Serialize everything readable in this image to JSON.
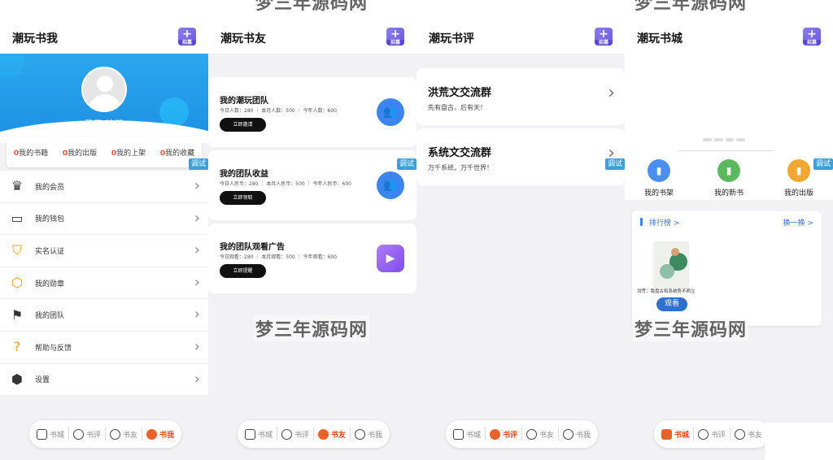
{
  "watermark": "梦三年源码网",
  "debug_label": "调试",
  "tabs": {
    "mall": "书城",
    "review": "书评",
    "friends": "书友",
    "me": "书我"
  },
  "corner_badge": "招募",
  "screen1": {
    "title": "潮玩书我",
    "login": "登录/注册",
    "stats": [
      {
        "num": "0",
        "label": "我的书籍"
      },
      {
        "num": "0",
        "label": "我的出版"
      },
      {
        "num": "0",
        "label": "我的上架"
      },
      {
        "num": "0",
        "label": "我的收藏"
      }
    ],
    "menu": [
      {
        "label": "我的会员",
        "icon": "crown-icon"
      },
      {
        "label": "我的钱包",
        "icon": "wallet-icon"
      },
      {
        "label": "实名认证",
        "icon": "shield-check-icon"
      },
      {
        "label": "我的勋章",
        "icon": "medal-icon"
      },
      {
        "label": "我的团队",
        "icon": "flag-icon"
      },
      {
        "label": "帮助与反馈",
        "icon": "question-icon"
      },
      {
        "label": "设置",
        "icon": "settings-icon"
      }
    ]
  },
  "screen2": {
    "title": "潮玩书友",
    "cards": [
      {
        "title": "我的潮玩团队",
        "sub": "今日人数：280 ｜ 本月人数：500 ｜ 今年人数：600",
        "button": "立即邀请"
      },
      {
        "title": "我的团队收益",
        "sub": "今日人民币：280 ｜ 本月人民币：500 ｜ 今年人民币：600",
        "button": "立即领取"
      },
      {
        "title": "我的团队观看广告",
        "sub": "今日观看：280 ｜ 本月观看：500 ｜ 今年观看：600",
        "button": "立即提醒"
      }
    ]
  },
  "screen3": {
    "title": "潮玩书评",
    "groups": [
      {
        "name": "洪荒文交流群",
        "desc": "先有盘古，后有天！"
      },
      {
        "name": "系统文交流群",
        "desc": "万千系统，万千世界！"
      }
    ]
  },
  "screen4": {
    "title": "潮玩书城",
    "quick": [
      {
        "label": "我的书架",
        "color": "#4a8ff0"
      },
      {
        "label": "我的新书",
        "color": "#5cb85c"
      },
      {
        "label": "我的出版",
        "color": "#f0a830"
      }
    ],
    "rank_title": "排行榜 >",
    "switch": "换一换 >",
    "book_name": "洪荒：我盘古和系统势不两立",
    "watch": "观看"
  }
}
